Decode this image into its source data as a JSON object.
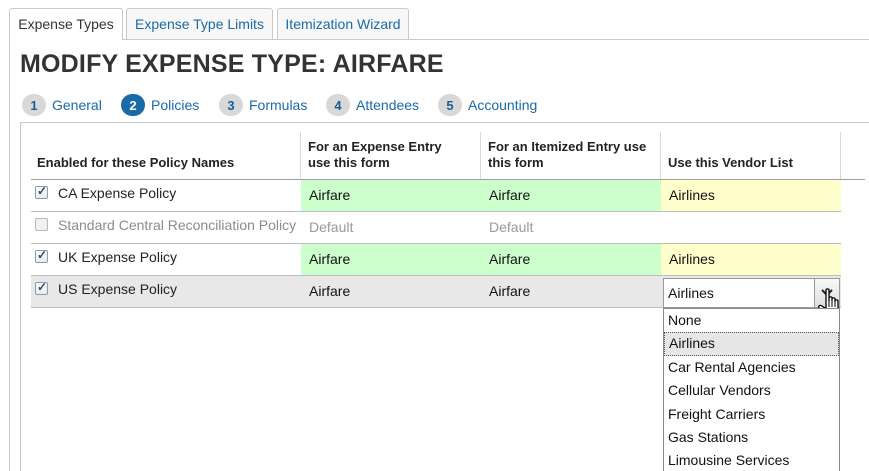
{
  "tabs": [
    {
      "label": "Expense Types",
      "active": true
    },
    {
      "label": "Expense Type Limits",
      "active": false
    },
    {
      "label": "Itemization Wizard",
      "active": false
    }
  ],
  "title": "MODIFY EXPENSE TYPE: AIRFARE",
  "steps": [
    {
      "num": "1",
      "label": "General",
      "current": false
    },
    {
      "num": "2",
      "label": "Policies",
      "current": true
    },
    {
      "num": "3",
      "label": "Formulas",
      "current": false
    },
    {
      "num": "4",
      "label": "Attendees",
      "current": false
    },
    {
      "num": "5",
      "label": "Accounting",
      "current": false
    }
  ],
  "table": {
    "headers": {
      "policy": "Enabled for these Policy Names",
      "expense_form_l1": "For an Expense Entry",
      "expense_form_l2": "use this form",
      "itemized_form_l1": "For an Itemized Entry use",
      "itemized_form_l2": "this form",
      "vendor_list": "Use this Vendor List"
    },
    "rows": [
      {
        "policy": "CA Expense Policy",
        "enabled": true,
        "expense_form": "Airfare",
        "itemized_form": "Airfare",
        "vendor_list": "Airlines"
      },
      {
        "policy": "Standard Central Reconciliation Policy",
        "enabled": false,
        "expense_form": "Default",
        "itemized_form": "Default",
        "vendor_list": ""
      },
      {
        "policy": "UK Expense Policy",
        "enabled": true,
        "expense_form": "Airfare",
        "itemized_form": "Airfare",
        "vendor_list": "Airlines"
      },
      {
        "policy": "US Expense Policy",
        "enabled": true,
        "expense_form": "Airfare",
        "itemized_form": "Airfare",
        "vendor_list": "Airlines"
      }
    ]
  },
  "vendor_dropdown": {
    "selected": "Airlines",
    "options": [
      "None",
      "Airlines",
      "Car Rental Agencies",
      "Cellular Vendors",
      "Freight Carriers",
      "Gas Stations",
      "Limousine Services"
    ],
    "highlighted": "Airlines"
  },
  "colors": {
    "link": "#1a6aa8",
    "green_cell": "#ccffcc",
    "yellow_cell": "#ffffcc",
    "selected_row": "#e8e8e8"
  }
}
